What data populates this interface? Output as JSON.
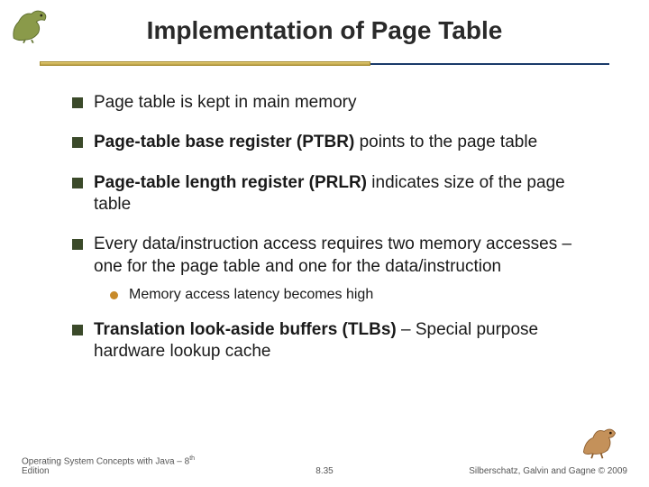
{
  "title": "Implementation of Page Table",
  "bullets": [
    {
      "html": "Page table is kept in main memory"
    },
    {
      "html": "<b>Page-table base register (PTBR)</b> points to the page table"
    },
    {
      "html": "<b>Page-table length register (PRLR)</b> indicates size of the page table"
    },
    {
      "html": "Every data/instruction access requires two memory accesses – one for the page table and one for the data/instruction"
    }
  ],
  "sub_bullet": "Memory access latency becomes high",
  "last_bullet": {
    "html": "<b>Translation look-aside buffers (TLBs)</b> – Special purpose hardware lookup cache"
  },
  "footer": {
    "left": "Operating System Concepts with Java – 8",
    "left_sup": "th",
    "left_tail": " Edition",
    "center": "8.35",
    "right": "Silberschatz, Galvin and Gagne © 2009"
  }
}
